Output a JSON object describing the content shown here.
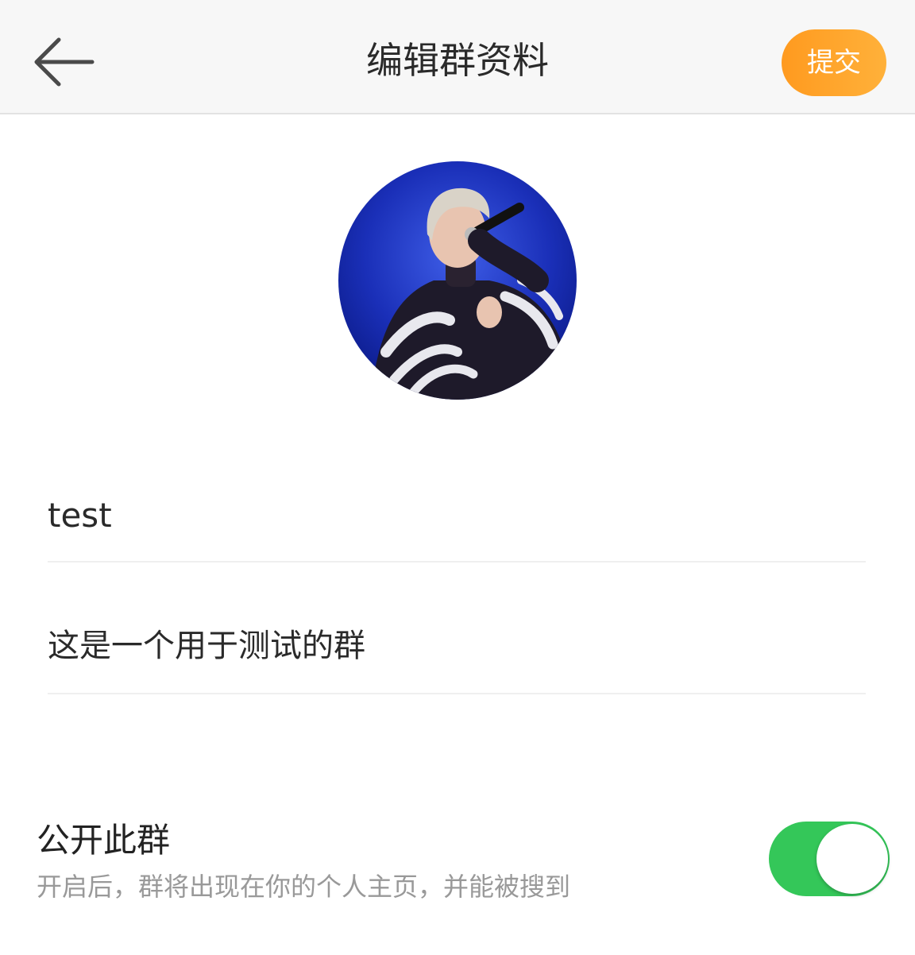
{
  "header": {
    "title": "编辑群资料",
    "back_icon": "arrow-left-icon",
    "submit_label": "提交"
  },
  "avatar": {
    "description_icon": "group-avatar-image"
  },
  "form": {
    "name_value": "test",
    "description_value": "这是一个用于测试的群"
  },
  "public_setting": {
    "title": "公开此群",
    "hint": "开启后，群将出现在你的个人主页，并能被搜到",
    "enabled": true
  },
  "colors": {
    "accent": "#ff9f24",
    "toggle_on": "#34c759",
    "hint_text": "#999999"
  }
}
